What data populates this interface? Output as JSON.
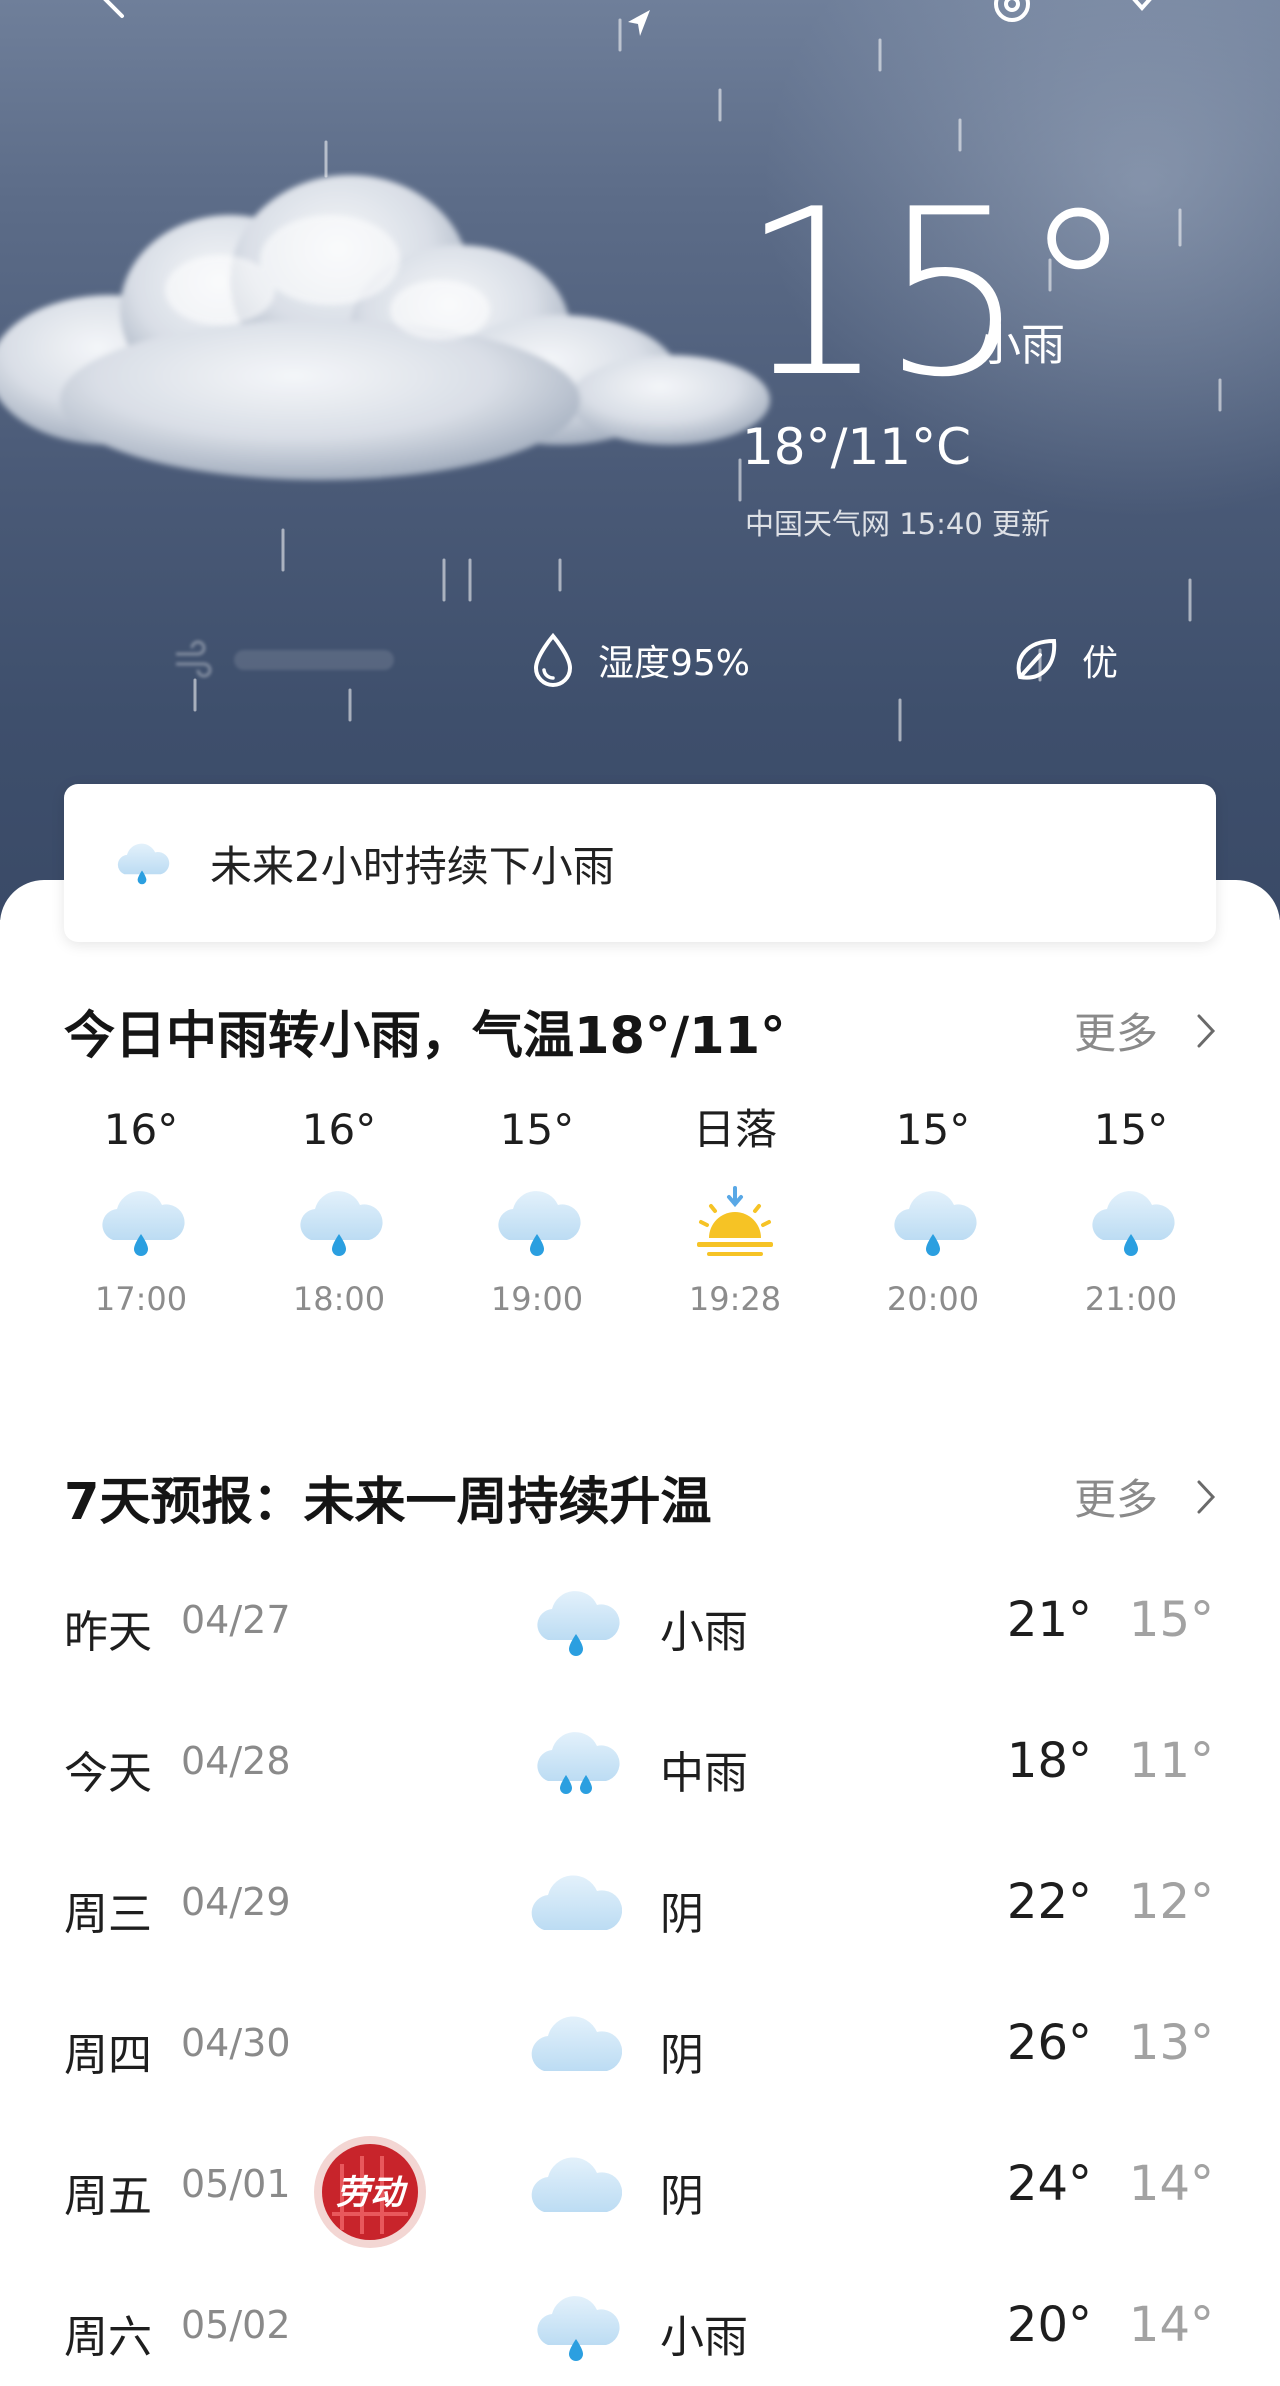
{
  "colors": {
    "sky_top": "#6f7f9a",
    "sky_bottom": "#3a4a67",
    "rain_icon": "#2b9fe0",
    "cloud_icon": "#c9e3f6",
    "sun_icon": "#f6c325",
    "holiday_badge": "#c8242b"
  },
  "current": {
    "temperature": "15°",
    "condition": "小雨",
    "range": "18°/11°C",
    "updated": "中国天气网 15:40 更新",
    "humidity": "湿度95%",
    "air_quality": "优",
    "icons": {
      "humidity": "droplet-icon",
      "air_quality": "leaf-icon",
      "wind": "wind-icon"
    }
  },
  "nowcast": {
    "text": "未来2小时持续下小雨",
    "icon": "rain-cloud-icon"
  },
  "today": {
    "title": "今日中雨转小雨，气温18°/11°",
    "more_label": "更多",
    "hours": [
      {
        "temp": "16°",
        "time": "17:00",
        "icon": "rain"
      },
      {
        "temp": "16°",
        "time": "18:00",
        "icon": "rain"
      },
      {
        "temp": "15°",
        "time": "19:00",
        "icon": "rain"
      },
      {
        "temp": "日落",
        "time": "19:28",
        "icon": "sunset"
      },
      {
        "temp": "15°",
        "time": "20:00",
        "icon": "rain"
      },
      {
        "temp": "15°",
        "time": "21:00",
        "icon": "rain"
      }
    ]
  },
  "week": {
    "title": "7天预报：未来一周持续升温",
    "more_label": "更多",
    "days": [
      {
        "name": "昨天",
        "date": "04/27",
        "icon": "rain",
        "cond": "小雨",
        "hi": "21°",
        "lo": "15°"
      },
      {
        "name": "今天",
        "date": "04/28",
        "icon": "moderate-rain",
        "cond": "中雨",
        "hi": "18°",
        "lo": "11°"
      },
      {
        "name": "周三",
        "date": "04/29",
        "icon": "overcast",
        "cond": "阴",
        "hi": "22°",
        "lo": "12°"
      },
      {
        "name": "周四",
        "date": "04/30",
        "icon": "overcast",
        "cond": "阴",
        "hi": "26°",
        "lo": "13°"
      },
      {
        "name": "周五",
        "date": "05/01",
        "icon": "overcast",
        "cond": "阴",
        "hi": "24°",
        "lo": "14°",
        "badge": "劳动"
      },
      {
        "name": "周六",
        "date": "05/02",
        "icon": "rain",
        "cond": "小雨",
        "hi": "20°",
        "lo": "14°"
      }
    ]
  }
}
